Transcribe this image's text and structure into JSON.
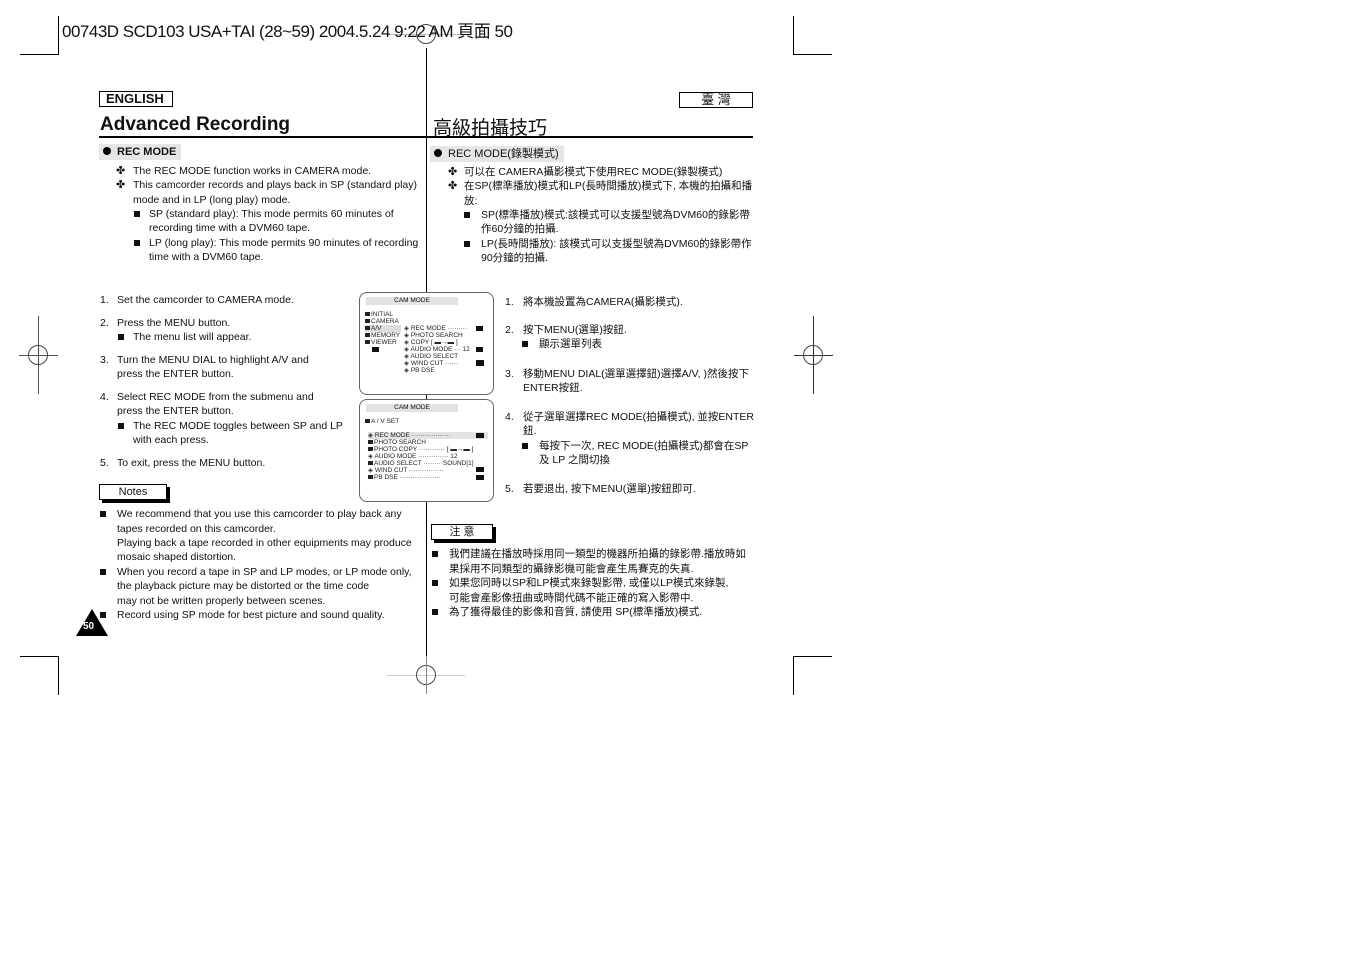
{
  "print_header": "00743D SCD103 USA+TAI (28~59) 2004.5.24  9:22 AM 頁面 50",
  "left": {
    "language_tag": "ENGLISH",
    "title": "Advanced Recording",
    "section": "REC MODE",
    "intro": [
      {
        "bullet": "cross",
        "lines": [
          "The REC MODE function works in CAMERA mode."
        ]
      },
      {
        "bullet": "cross",
        "lines": [
          "This camcorder records and plays back in SP (standard play)",
          "mode and in LP (long play) mode."
        ]
      },
      {
        "bullet": "square",
        "lines": [
          "SP (standard play): This mode permits 60 minutes of",
          "recording time with a DVM60 tape."
        ]
      },
      {
        "bullet": "square",
        "lines": [
          "LP (long play): This mode permits 90 minutes of recording",
          "time with a DVM60 tape."
        ]
      }
    ],
    "steps": [
      {
        "num": "1.",
        "lines": [
          "Set the camcorder to CAMERA mode."
        ]
      },
      {
        "num": "2.",
        "lines": [
          "Press the MENU button."
        ],
        "sub": [
          "The menu list will appear."
        ]
      },
      {
        "num": "3.",
        "lines": [
          "Turn the MENU DIAL to highlight A/V and",
          "press the ENTER button."
        ]
      },
      {
        "num": "4.",
        "lines": [
          "Select REC MODE from the submenu and",
          "press the ENTER button."
        ],
        "sub": [
          "The REC MODE toggles between SP and LP",
          "with each press."
        ]
      },
      {
        "num": "5.",
        "lines": [
          "To exit, press the MENU button."
        ]
      }
    ],
    "notes_label": "Notes",
    "notes": [
      [
        "We recommend that you use this camcorder to play back any",
        "tapes recorded on this camcorder.",
        "Playing back a tape recorded in other equipments may produce",
        "mosaic shaped distortion."
      ],
      [
        "When you record a tape in SP and LP modes, or LP mode only,",
        "the playback picture may be distorted or the time code",
        "may not be written properly between scenes."
      ],
      [
        "Record using SP mode for best picture and sound quality."
      ]
    ],
    "page_number": "50"
  },
  "right": {
    "language_tag": "臺 灣",
    "title": "高級拍攝技巧",
    "section": "REC MODE(錄製模式)",
    "intro": [
      {
        "bullet": "cross",
        "lines": [
          "可以在 CAMERA攝影模式下使用REC MODE(錄製模式)"
        ]
      },
      {
        "bullet": "cross",
        "lines": [
          "在SP(標準播放)模式和LP(長時間播放)模式下, 本機的拍攝和播",
          "放:"
        ]
      },
      {
        "bullet": "square",
        "lines": [
          "SP(標準播放)模式:該模式可以支援型號為DVM60的錄影帶",
          "作60分鐘的拍攝."
        ]
      },
      {
        "bullet": "square",
        "lines": [
          "LP(長時間播放): 該模式可以支援型號為DVM60的錄影帶作",
          "90分鐘的拍攝."
        ]
      }
    ],
    "steps": [
      {
        "num": "1.",
        "lines": [
          "將本機設置為CAMERA(攝影模式)."
        ]
      },
      {
        "num": "2.",
        "lines": [
          "按下MENU(選單)按鈕."
        ],
        "sub": [
          "顯示選單列表"
        ]
      },
      {
        "num": "3.",
        "lines": [
          "移動MENU DIAL(選單選擇鈕)選擇A/V, )然後按下",
          "ENTER按鈕."
        ]
      },
      {
        "num": "4.",
        "lines": [
          "從子選單選擇REC MODE(拍攝模式), 並按ENTER",
          "鈕."
        ],
        "sub": [
          "每按下一次, REC MODE(拍攝模式)都會在SP",
          "及 LP 之間切換"
        ]
      },
      {
        "num": "5.",
        "lines": [
          "若要退出, 按下MENU(選單)按鈕即可."
        ]
      }
    ],
    "notes_label": "注 意",
    "notes": [
      [
        "我們建議在播放時採用同一類型的機器所拍攝的錄影帶.播放時如",
        "果採用不同類型的攝錄影機可能會產生馬賽克的失真."
      ],
      [
        "如果您同時以SP和LP模式來錄製影帶, 或僅以LP模式來錄製,",
        "可能會產影像扭曲或時間代碼不能正確的寫入影帶中."
      ],
      [
        "為了獲得最佳的影像和音質, 請使用 SP(標準播放)模式."
      ]
    ]
  },
  "screen1": {
    "header": "CAM  MODE",
    "menu": [
      "INITIAL",
      "CAMERA",
      "A/V",
      "MEMORY",
      "VIEWER"
    ],
    "selected": "A/V",
    "submenu": [
      {
        "label": "REC MODE",
        "value": "·········"
      },
      {
        "label": "PHOTO SEARCH",
        "value": ""
      },
      {
        "label": "COPY",
        "value": "[ ▬→▬ ]"
      },
      {
        "label": "AUDIO MODE",
        "value": "··· 12"
      },
      {
        "label": "AUDIO SELECT",
        "value": ""
      },
      {
        "label": "WIND CUT",
        "value": "······"
      },
      {
        "label": "PB DSE",
        "value": ""
      }
    ]
  },
  "screen2": {
    "header": "CAM  MODE",
    "title": "A / V SET",
    "items": [
      {
        "label": "REC MODE",
        "value": "··················"
      },
      {
        "label": "PHOTO SEARCH",
        "value": ""
      },
      {
        "label": "PHOTO COPY",
        "value": "············ [ ▬→▬ ]"
      },
      {
        "label": "AUDIO MODE",
        "value": "·············· 12"
      },
      {
        "label": "AUDIO SELECT",
        "value": "·········SOUND[1]"
      },
      {
        "label": "WIND CUT",
        "value": "················"
      },
      {
        "label": "PB DSE",
        "value": "···················"
      }
    ],
    "selected": "REC MODE"
  }
}
